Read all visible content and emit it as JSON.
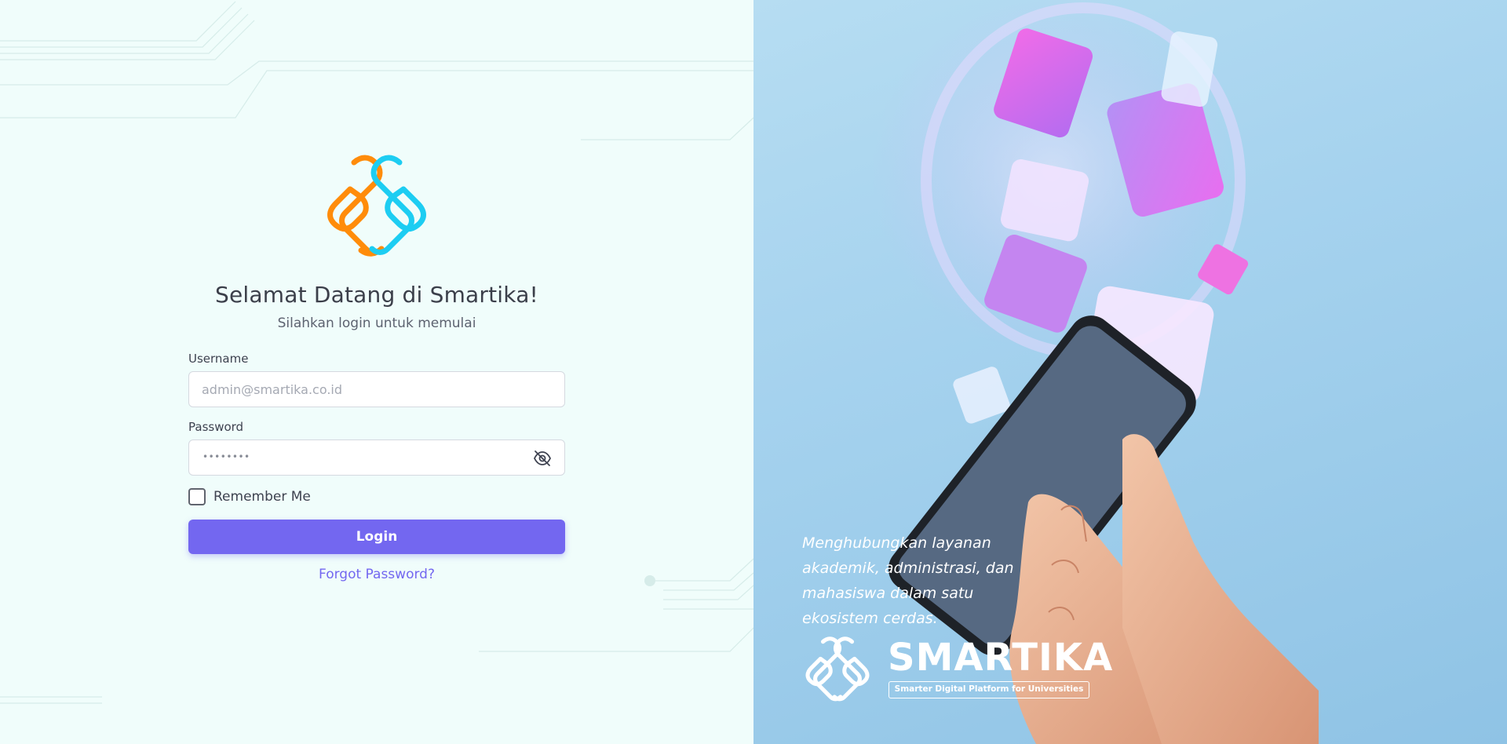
{
  "welcome": {
    "title": "Selamat Datang di Smartika!",
    "subtitle": "Silahkan login untuk memulai"
  },
  "form": {
    "username_label": "Username",
    "username_placeholder": "admin@smartika.co.id",
    "password_label": "Password",
    "password_masked": "••••••••",
    "remember_label": "Remember Me",
    "login_label": "Login",
    "forgot_label": "Forgot Password?"
  },
  "hero": {
    "tagline": "Menghubungkan layanan akademik, administrasi, dan mahasiswa dalam satu ekosistem cerdas.",
    "brand_name": "SMARTIKA",
    "brand_sub": "Smarter Digital Platform for Universities"
  },
  "icons": {
    "password_toggle": "eye-off-icon",
    "logo": "smartika-logo"
  },
  "colors": {
    "primary": "#7367f0",
    "logo_orange": "#ff8c0a",
    "logo_cyan": "#1dcdf2",
    "left_bg": "#f0fdfb",
    "right_bg": "#a5d2ee"
  }
}
